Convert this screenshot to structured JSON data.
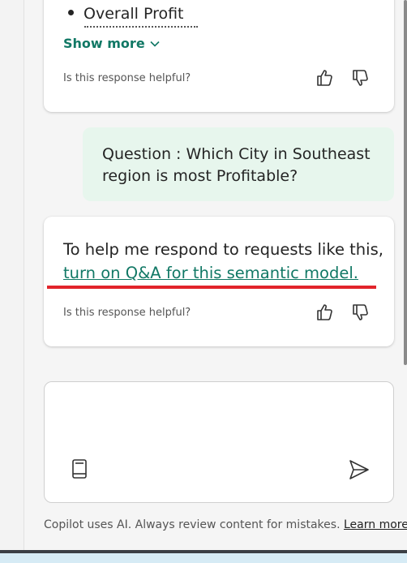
{
  "card1": {
    "bullet_text": "Overall Profit",
    "show_more_label": "Show more",
    "helpful_prompt": "Is this response helpful?"
  },
  "question": {
    "text": "Question : Which City in Southeast region is most Profitable?"
  },
  "response": {
    "text_before_link": "To help me respond to requests like this, ",
    "link_text": "turn on Q&A for this semantic model.",
    "helpful_prompt": "Is this response helpful?"
  },
  "composer": {
    "placeholder": ""
  },
  "footer": {
    "disclaimer": "Copilot uses AI. Always review content for mistakes. ",
    "learn_more": "Learn more"
  },
  "icons": {
    "thumbs_up": "thumbs-up-icon",
    "thumbs_down": "thumbs-down-icon",
    "chevron": "chevron-down-icon",
    "book": "book-icon",
    "send": "send-icon"
  },
  "colors": {
    "accent_green": "#117865",
    "question_bg": "#e7f6ed",
    "annotation_red": "#e2242b"
  }
}
